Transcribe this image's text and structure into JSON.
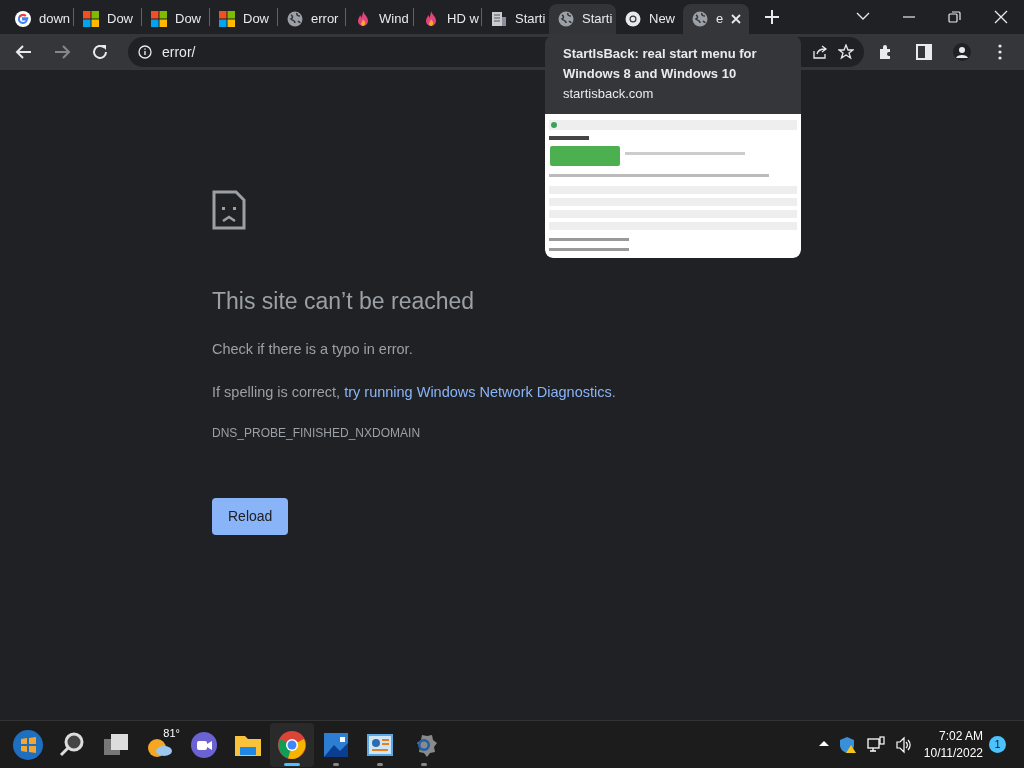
{
  "tabs": [
    {
      "label": "down",
      "kind": "google",
      "selected": false,
      "hovered": false
    },
    {
      "label": "Dow",
      "kind": "windows",
      "selected": false,
      "hovered": false
    },
    {
      "label": "Dow",
      "kind": "windows",
      "selected": false,
      "hovered": false
    },
    {
      "label": "Dow",
      "kind": "windows",
      "selected": false,
      "hovered": false
    },
    {
      "label": "error",
      "kind": "globe",
      "selected": false,
      "hovered": false
    },
    {
      "label": "Wind",
      "kind": "flame",
      "selected": false,
      "hovered": false
    },
    {
      "label": "HD w",
      "kind": "flame",
      "selected": false,
      "hovered": false
    },
    {
      "label": "Starti",
      "kind": "document",
      "selected": false,
      "hovered": false
    },
    {
      "label": "Starti",
      "kind": "globe",
      "selected": false,
      "hovered": true
    },
    {
      "label": "New",
      "kind": "chrome",
      "selected": false,
      "hovered": false
    },
    {
      "label": "e",
      "kind": "globe",
      "selected": true,
      "hovered": false
    }
  ],
  "toolbar": {
    "back_disabled": false,
    "forward_disabled": true,
    "address": "error/"
  },
  "tab_preview": {
    "title": "StartIsBack: real start menu for Windows 8 and Windows 10",
    "domain": "startisback.com"
  },
  "error_page": {
    "title": "This site can’t be reached",
    "line_1": "Check if there is a typo in error.",
    "line_2_before": "If spelling is correct, ",
    "line_2_link": "try running Windows Network Diagnostics",
    "line_2_after": ".",
    "code": "DNS_PROBE_FINISHED_NXDOMAIN",
    "button": "Reload"
  },
  "taskbar": {
    "apps": [
      {
        "kind": "start",
        "running": false,
        "active": false
      },
      {
        "kind": "search",
        "running": false,
        "active": false
      },
      {
        "kind": "taskview",
        "running": false,
        "active": false
      },
      {
        "kind": "weather",
        "running": false,
        "active": false,
        "label": "81°"
      },
      {
        "kind": "chat",
        "running": false,
        "active": false
      },
      {
        "kind": "explorer",
        "running": false,
        "active": false
      },
      {
        "kind": "chrome",
        "running": true,
        "active": true
      },
      {
        "kind": "photos",
        "running": true,
        "active": false
      },
      {
        "kind": "control",
        "running": true,
        "active": false
      },
      {
        "kind": "settings",
        "running": true,
        "active": false
      }
    ],
    "time": "7:02 AM",
    "date": "10/11/2022",
    "notifications": "1"
  }
}
